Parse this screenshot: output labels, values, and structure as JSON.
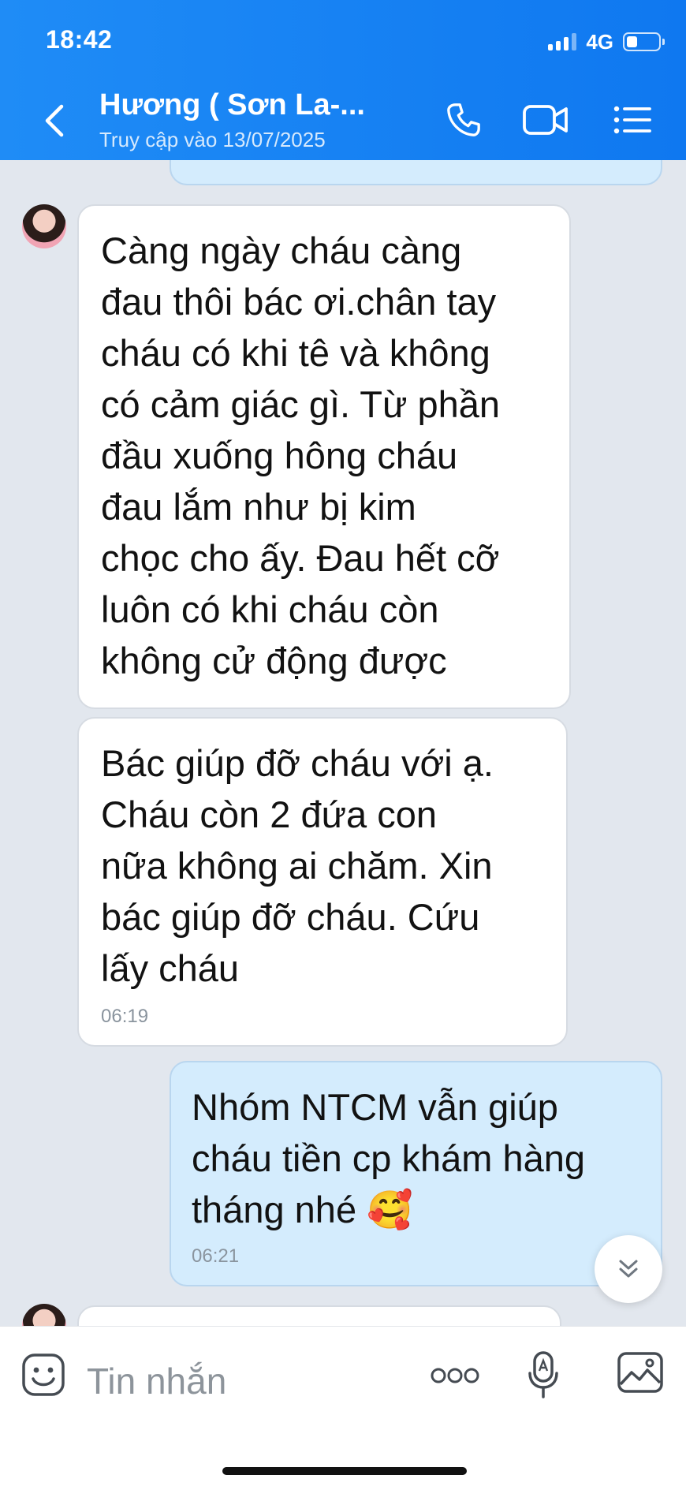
{
  "status_bar": {
    "time": "18:42",
    "network": "4G",
    "battery_level": 0.35
  },
  "header": {
    "contact_name": "Hương ( Sơn La-...",
    "last_seen": "Truy cập vào 13/07/2025",
    "icons": [
      "back-chevron-icon",
      "phone-icon",
      "video-call-icon",
      "menu-list-icon"
    ],
    "background_color": "#1a84f4"
  },
  "messages": [
    {
      "sender": "contact",
      "text_lines": [
        "Càng ngày cháu càng",
        "đau thôi bác ơi.chân tay",
        "cháu có khi tê và không",
        "có cảm giác gì. Từ phần",
        "đầu xuống hông cháu",
        "đau lắm như bị kim",
        "chọc cho ấy. Đau hết cỡ",
        "luôn có khi cháu còn",
        "không cử động được"
      ]
    },
    {
      "sender": "contact",
      "text_lines": [
        "Bác giúp đỡ cháu với ạ.",
        "Cháu còn 2 đứa con",
        "nữa không ai chăm. Xin",
        "bác giúp đỡ cháu. Cứu",
        "lấy cháu"
      ],
      "time": "06:19"
    },
    {
      "sender": "me",
      "text_lines": [
        "Nhóm NTCM vẫn giúp",
        "cháu tiền cp khám hàng",
        "tháng nhé 🥰"
      ],
      "time": "06:21"
    }
  ],
  "input": {
    "placeholder": "Tin nhắn"
  },
  "colors": {
    "my_bubble": "#d4ecfd",
    "their_bubble": "#ffffff",
    "chat_background": "#e2e7ee"
  }
}
